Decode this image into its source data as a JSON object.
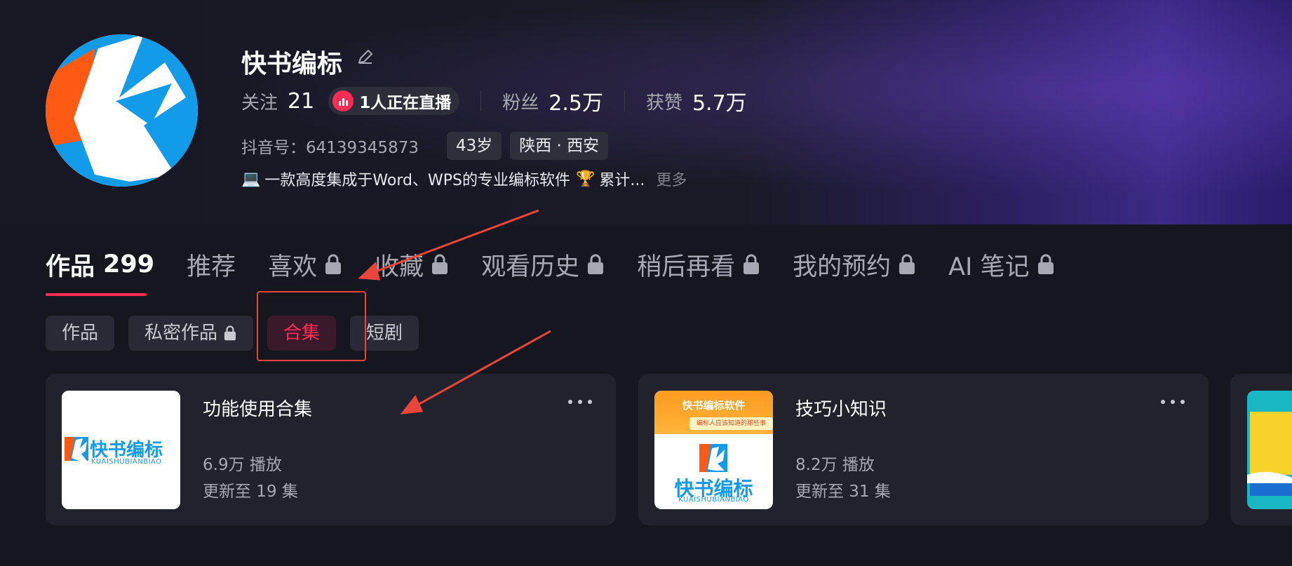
{
  "profile": {
    "name": "快书编标",
    "follow_label": "关注",
    "follow_count": "21",
    "live_text": "1人正在直播",
    "fans_label": "粉丝",
    "fans_count": "2.5万",
    "likes_label": "获赞",
    "likes_count": "5.7万",
    "douyin_id": "抖音号：64139345873",
    "age_tag": "43岁",
    "location_tag": "陕西 · 西安",
    "bio_emoji_1": "💻",
    "bio": "一款高度集成于Word、WPS的专业编标软件",
    "bio_emoji_2": "🏆",
    "bio_tail": "累计...",
    "more_label": "更多"
  },
  "tabs": [
    {
      "label": "作品",
      "count": "299",
      "locked": false,
      "active": true
    },
    {
      "label": "推荐",
      "locked": false
    },
    {
      "label": "喜欢",
      "locked": true
    },
    {
      "label": "收藏",
      "locked": true
    },
    {
      "label": "观看历史",
      "locked": true
    },
    {
      "label": "稍后再看",
      "locked": true
    },
    {
      "label": "我的预约",
      "locked": true
    },
    {
      "label": "AI 笔记",
      "locked": true
    }
  ],
  "subtabs": [
    {
      "label": "作品",
      "locked": false
    },
    {
      "label": "私密作品",
      "locked": true
    },
    {
      "label": "合集",
      "locked": false,
      "active": true
    },
    {
      "label": "短剧",
      "locked": false
    }
  ],
  "collections": [
    {
      "title": "功能使用合集",
      "plays": "6.9万 播放",
      "updates": "更新至 19 集",
      "thumb_brand": "快书编标",
      "thumb_sub": "KUAISHUBIANBIAO"
    },
    {
      "title": "技巧小知识",
      "plays": "8.2万 播放",
      "updates": "更新至 31 集",
      "thumb_header": "快书编标软件",
      "thumb_banner": "编标人应该知道的那些事",
      "thumb_brand": "快书编标",
      "thumb_sub": "KUAISHUBIANBIAO"
    }
  ],
  "colors": {
    "accent": "#fe2c55",
    "annotation": "#e8463c",
    "brand_blue": "#129be8",
    "brand_orange": "#ff5a14"
  }
}
